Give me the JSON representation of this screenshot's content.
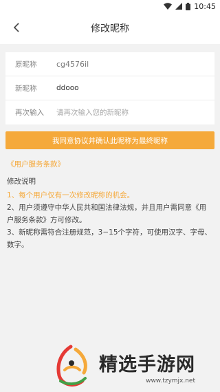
{
  "status_bar": {
    "time": "10:45"
  },
  "app_bar": {
    "title": "修改昵称"
  },
  "form": {
    "original": {
      "label": "原昵称",
      "value": "cg4576il"
    },
    "new": {
      "label": "新昵称",
      "value": "ddooo"
    },
    "confirm": {
      "label": "再次输入",
      "placeholder": "请再次输入您的新昵称",
      "value": ""
    }
  },
  "confirm_button": {
    "label": "我同意协议并确认此昵称为最终昵称"
  },
  "terms_link": {
    "label": "《用户服务条款》"
  },
  "notes": {
    "title": "修改说明",
    "items": [
      "1、每个用户仅有一次修改昵称的机会。",
      "2、用户须遵守中华人民共和国法律法规，并且用户需同意《用户服务条款》方可修改。",
      "3、新昵称需符合注册规范，3−15个字符，可使用汉字、字母、数字。"
    ]
  },
  "watermark": {
    "title": "精选手游网",
    "url": "www.tzymjx.net"
  },
  "colors": {
    "accent": "#f5a93b",
    "background": "#f2f2f2"
  }
}
